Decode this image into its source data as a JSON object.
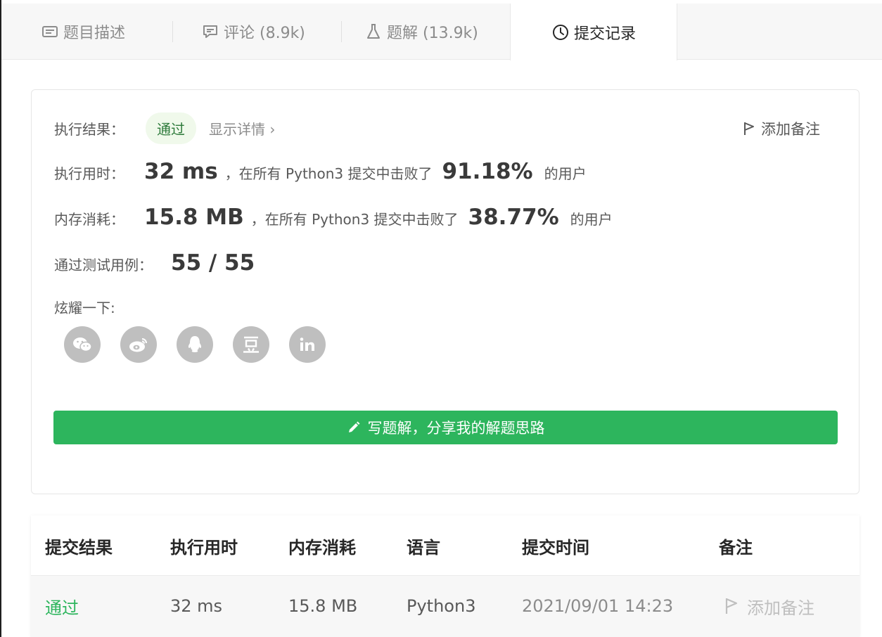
{
  "tabs": [
    {
      "label": "题目描述",
      "icon": "description-icon"
    },
    {
      "label": "评论 (8.9k)",
      "icon": "comment-icon"
    },
    {
      "label": "题解 (13.9k)",
      "icon": "flask-icon"
    },
    {
      "label": "提交记录",
      "icon": "clock-icon"
    }
  ],
  "result": {
    "exec_result_label": "执行结果：",
    "status": "通过",
    "details_link": "显示详情 ›",
    "add_note": "添加备注",
    "runtime_label": "执行用时：",
    "runtime_value": "32 ms",
    "runtime_mid": "，在所有 Python3 提交中击败了",
    "runtime_percent": "91.18%",
    "runtime_suffix": "的用户",
    "memory_label": "内存消耗：",
    "memory_value": "15.8 MB",
    "memory_mid": "，在所有 Python3 提交中击败了",
    "memory_percent": "38.77%",
    "memory_suffix": "的用户",
    "tests_label": "通过测试用例：",
    "tests_value": "55 / 55",
    "share_label": "炫耀一下:",
    "share": [
      {
        "name": "wechat-icon",
        "glyph": "✉"
      },
      {
        "name": "weibo-icon",
        "glyph": "◉"
      },
      {
        "name": "qq-icon",
        "glyph": "♟"
      },
      {
        "name": "douban-icon",
        "glyph": "豆"
      },
      {
        "name": "linkedin-icon",
        "glyph": "in"
      }
    ],
    "write_solution": "写题解，分享我的解题思路"
  },
  "table": {
    "headers": [
      "提交结果",
      "执行用时",
      "内存消耗",
      "语言",
      "提交时间",
      "备注"
    ],
    "row": {
      "result": "通过",
      "runtime": "32 ms",
      "memory": "15.8 MB",
      "language": "Python3",
      "time": "2021/09/01 14:23",
      "note": "添加备注"
    }
  },
  "colors": {
    "accent": "#2db55d",
    "badge_bg": "#f0f9eb"
  }
}
